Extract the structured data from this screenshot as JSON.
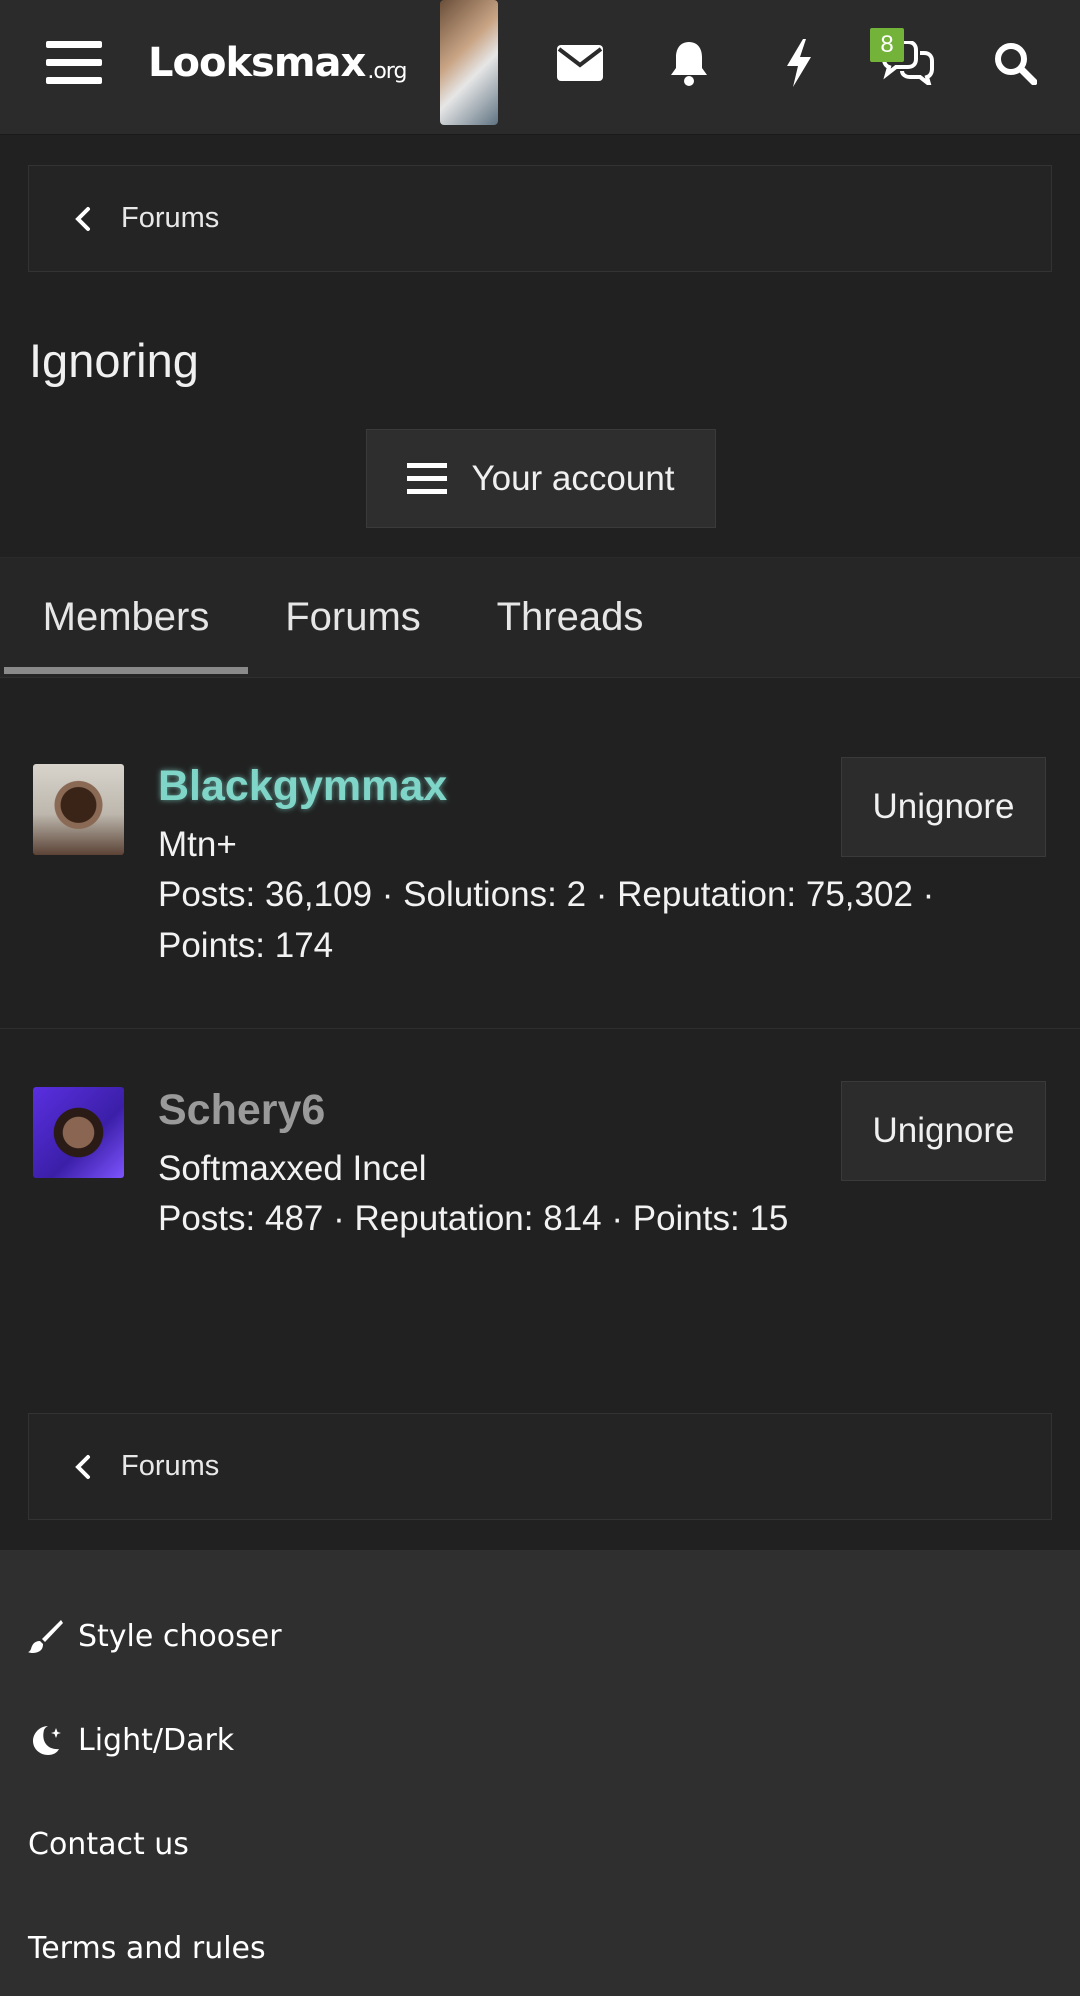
{
  "header": {
    "logo_main": "Looksmax",
    "logo_suffix": ".org",
    "chat_badge": "8"
  },
  "breadcrumb_top": {
    "label": "Forums"
  },
  "page": {
    "title": "Ignoring"
  },
  "account_button": {
    "label": "Your account"
  },
  "tabs": [
    {
      "label": "Members",
      "active": true
    },
    {
      "label": "Forums",
      "active": false
    },
    {
      "label": "Threads",
      "active": false
    }
  ],
  "members": [
    {
      "name": "Blackgymmax",
      "name_color": "#7fd6c8",
      "title": "Mtn+",
      "stats_line1": "Posts: 36,109 · Solutions: 2 · Reputation: 75,302 ·",
      "stats_line2": "Points: 174",
      "action": "Unignore"
    },
    {
      "name": "Schery6",
      "name_color": "#9a9a9a",
      "title": "Softmaxxed Incel",
      "stats_line1": "Posts: 487 · Reputation: 814 · Points: 15",
      "action": "Unignore"
    }
  ],
  "breadcrumb_bottom": {
    "label": "Forums"
  },
  "footer": {
    "style_chooser": "Style chooser",
    "light_dark": "Light/Dark",
    "contact": "Contact us",
    "terms": "Terms and rules"
  },
  "colors": {
    "background": "#212121",
    "header": "#2b2b2b",
    "footer": "#2f2f2f",
    "badge": "#74b33a"
  }
}
